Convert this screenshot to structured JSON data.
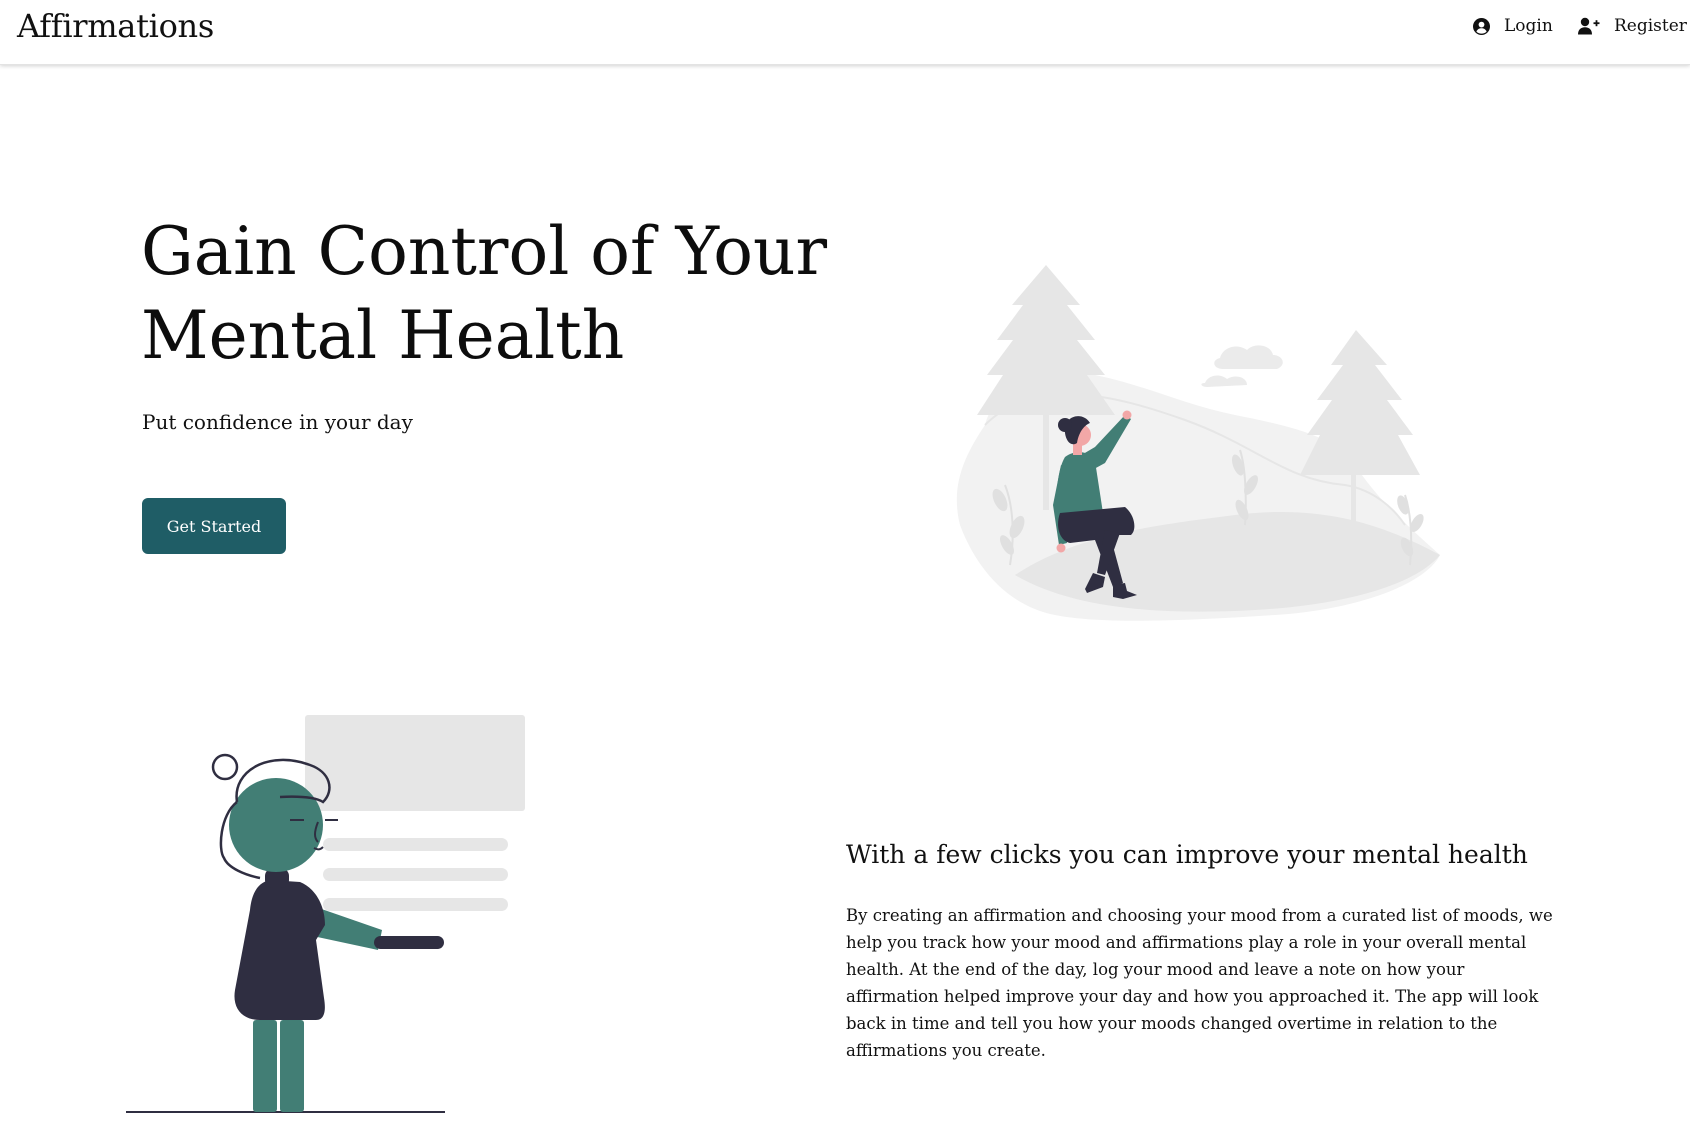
{
  "header": {
    "brand": "Affirmations",
    "login_label": "Login",
    "register_label": "Register",
    "login_icon": "user-circle-icon",
    "register_icon": "user-plus-icon"
  },
  "hero": {
    "title": "Gain Control of Your Mental Health",
    "subtitle": "Put confidence in your day",
    "cta_label": "Get Started",
    "illustration": "woman-in-nature-illustration"
  },
  "feature": {
    "title": "With a few clicks you can improve your mental health",
    "body": "By creating an affirmation and choosing your mood from a curated list of moods, we help you track how your mood and affirmations play a role in your overall mental health. At the end of the day, log your mood and leave a note on how your affirmation helped improve your day and how you approached it. The app will look back in time and tell you how your moods changed overtime in relation to the affirmations you create.",
    "illustration": "person-pointing-at-board-illustration"
  },
  "colors": {
    "accent": "#1f5d66",
    "figure_green": "#427e75",
    "figure_dark": "#2f2e41",
    "scenery_gray": "#e6e6e6"
  }
}
